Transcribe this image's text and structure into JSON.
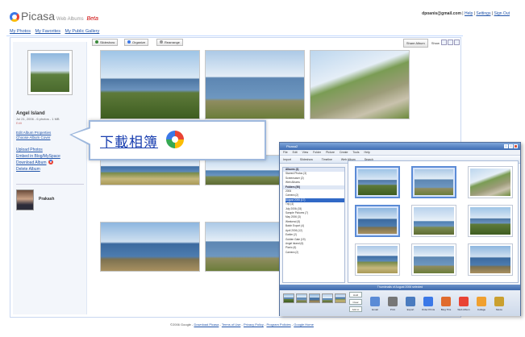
{
  "header": {
    "logo_text": "Picasa",
    "logo_sub": "Web Albums",
    "beta": "Beta",
    "account_email": "dpoanis@gmail.com",
    "links": [
      "Help",
      "Settings",
      "Sign Out"
    ]
  },
  "tabs": [
    "My Photos",
    "My Favorites",
    "My Public Gallery"
  ],
  "album": {
    "title": "Angel Island",
    "meta": "Jul 21, 2006 - 6 photos - 1 MB",
    "meta2": "Edit",
    "links_small": [
      "Edit Album Properties",
      "Choose Album Cover"
    ],
    "actions": [
      "Upload Photos",
      "Embed in Blog/MySpace",
      "Download Album",
      "Delete Album"
    ]
  },
  "user": {
    "name": "Prakash"
  },
  "toolbar": {
    "buttons": [
      "Slideshow",
      "Organize",
      "Rearrange"
    ],
    "share": "Share Album",
    "show": "Show"
  },
  "callout": {
    "text": "下載相簿"
  },
  "footer": {
    "copyright": "©2006 Google",
    "links": [
      "Download Picasa",
      "Terms of Use",
      "Privacy Policy",
      "Program Policies",
      "Google Home"
    ]
  },
  "desktop": {
    "title": "Picasa2",
    "menu": [
      "File",
      "Edit",
      "View",
      "Folder",
      "Picture",
      "Create",
      "Tools",
      "Help"
    ],
    "tools": [
      "Import",
      "Slideshow",
      "Timeline",
      "Web Album",
      "Search"
    ],
    "folders_header": "Folders (50)",
    "folders": [
      "Albums (4)",
      "Starred Photos (3)",
      "Screensaver (2)",
      "Web Albums",
      "Folders (50)",
      "2006",
      "Camera (2)",
      "August 2006 (17)",
      "Trip (4)",
      "July 2006 (15)",
      "Sample Pictures (7)",
      "May 2006 (3)",
      "Weekend (5)",
      "Batch Export (4)",
      "April 2006 (12)",
      "Earlier (2)",
      "Golden Gate (19)",
      "Angel Island (6)",
      "Picnic (6)",
      "Camera (2)"
    ],
    "status": "Thumbnails of August 2006 selected",
    "tray_buttons": [
      "Hold",
      "Clear",
      "Add to"
    ],
    "tray_actions": [
      "Email",
      "Print",
      "Export",
      "Order Prints",
      "Blog This",
      "Web Album",
      "Collage",
      "Movie"
    ]
  }
}
